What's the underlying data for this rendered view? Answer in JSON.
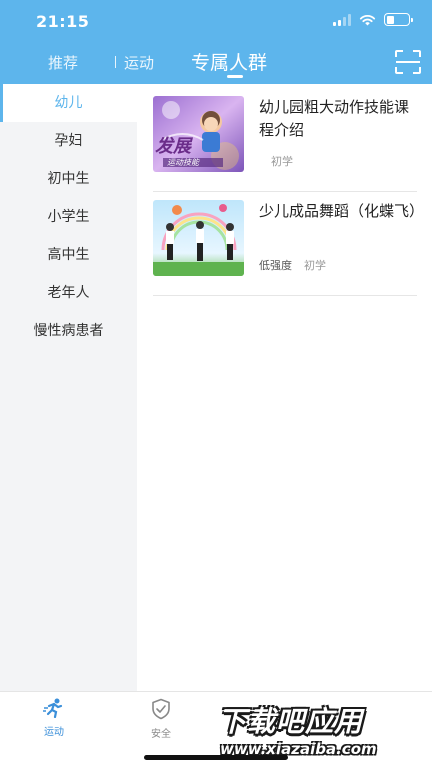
{
  "status_bar": {
    "time": "21:15",
    "battery_level": 0.35
  },
  "header": {
    "tabs": [
      {
        "label": "推荐",
        "active": false
      },
      {
        "label": "运动",
        "active": false
      },
      {
        "label": "专属人群",
        "active": true
      }
    ],
    "scan_icon": "scan-icon"
  },
  "sidebar": {
    "items": [
      {
        "label": "幼儿",
        "active": true
      },
      {
        "label": "孕妇",
        "active": false
      },
      {
        "label": "初中生",
        "active": false
      },
      {
        "label": "小学生",
        "active": false
      },
      {
        "label": "高中生",
        "active": false
      },
      {
        "label": "老年人",
        "active": false
      },
      {
        "label": "慢性病患者",
        "active": false
      }
    ]
  },
  "courses": [
    {
      "title": "幼儿园粗大动作技能课程介绍",
      "tags": [
        "",
        "初学"
      ],
      "thumb_text": "发展",
      "thumb_sub": "运动技能"
    },
    {
      "title": "少儿成品舞蹈（化蝶飞）",
      "tags": [
        "低强度",
        "初学"
      ]
    }
  ],
  "bottom_nav": {
    "items": [
      {
        "label": "运动",
        "icon": "running-icon",
        "active": true
      },
      {
        "label": "安全",
        "icon": "shield-check-icon",
        "active": false
      }
    ]
  },
  "watermark": {
    "main": "下载吧应用",
    "site": "www.xiazaiba.com"
  },
  "colors": {
    "primary": "#5db5ec",
    "active_nav": "#3b8fd9",
    "sidebar_bg": "#f3f4f6"
  }
}
